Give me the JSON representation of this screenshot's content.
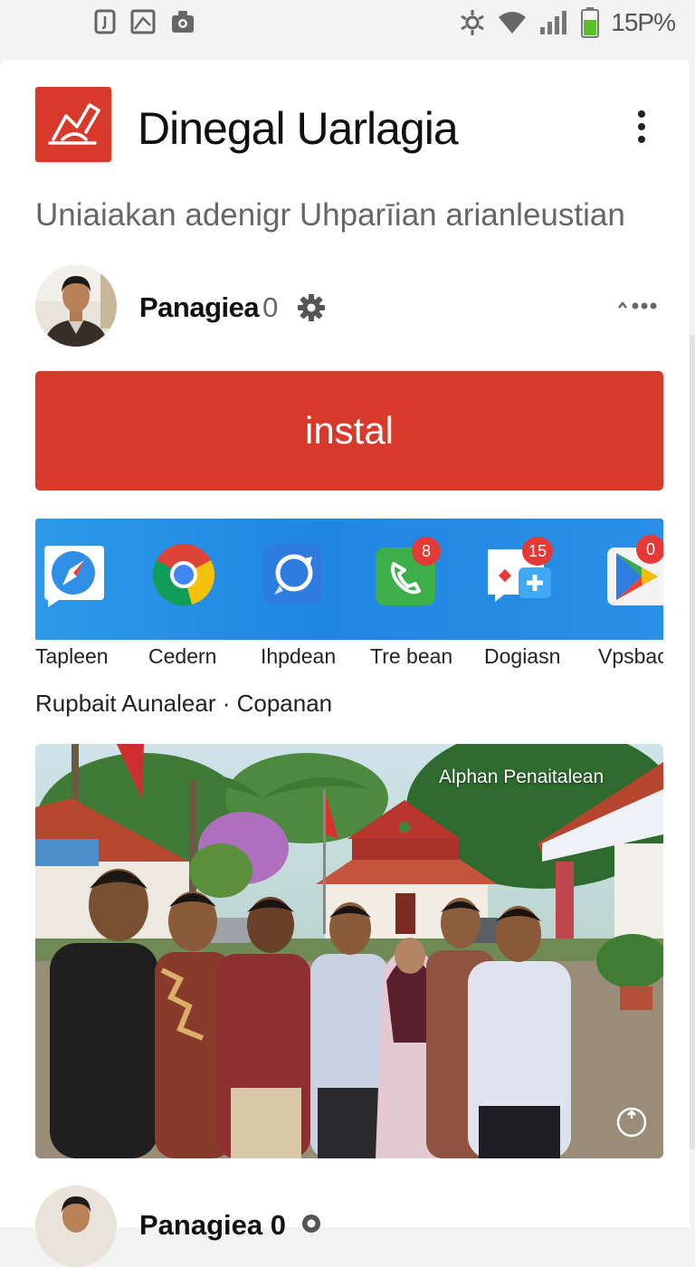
{
  "status_bar": {
    "time": "15P%",
    "icons": [
      "sim-card-icon",
      "image-icon",
      "camera-icon",
      "bluetooth-icon",
      "wifi-icon",
      "signal-icon",
      "battery-icon"
    ],
    "battery_color": "#5bbf2c"
  },
  "app": {
    "title": "Dinegal Uarlagia",
    "subtitle": "Uniaiakan adenigr Uhparīian arianleustian",
    "icon": "signature-icon",
    "brand_color": "#d7392b"
  },
  "developer": {
    "name": "Panagiea",
    "count": "0",
    "avatar": "person-avatar"
  },
  "install_button": {
    "label": "instal"
  },
  "apps_row": {
    "items": [
      {
        "label": "Tapleen",
        "icon": "compass-icon"
      },
      {
        "label": "Cedern",
        "icon": "chrome-icon"
      },
      {
        "label": "Ihpdean",
        "icon": "sync-chat-icon"
      },
      {
        "label": "Tre bean",
        "icon": "phone-icon",
        "badge": "8"
      },
      {
        "label": "Dogiasn",
        "icon": "messages-icon",
        "badge": "15"
      },
      {
        "label": "Vpsbac",
        "icon": "play-store-icon",
        "badge": "0"
      }
    ]
  },
  "section": {
    "heading": "Rupbait Aunalear · Copanan"
  },
  "photo": {
    "caption": "Alphan Penaitalean",
    "action_icon": "expand-icon"
  },
  "next_item": {
    "name": "Panagiea 0"
  },
  "colors": {
    "accent": "#d7392b",
    "strip_blue": "#2389e4",
    "text_secondary": "#666666"
  }
}
